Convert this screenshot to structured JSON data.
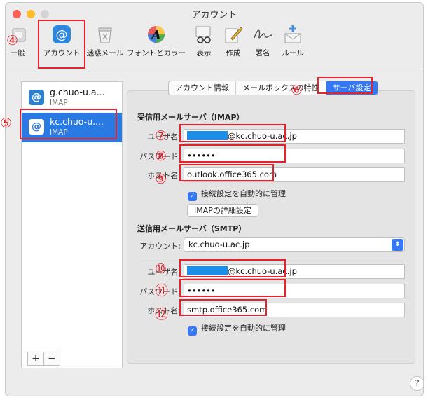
{
  "window": {
    "title": "アカウント"
  },
  "toolbar": {
    "items": [
      {
        "label": "一般",
        "icon": "general-icon"
      },
      {
        "label": "アカウント",
        "icon": "at-sign-icon"
      },
      {
        "label": "迷惑メール",
        "icon": "junk-mail-icon"
      },
      {
        "label": "フォントとカラー",
        "icon": "fonts-colors-icon"
      },
      {
        "label": "表示",
        "icon": "viewing-icon"
      },
      {
        "label": "作成",
        "icon": "composing-icon"
      },
      {
        "label": "署名",
        "icon": "signature-icon"
      },
      {
        "label": "ルール",
        "icon": "rules-icon"
      }
    ]
  },
  "sidebar": {
    "accounts": [
      {
        "name": "g.chuo-u.a...",
        "type": "IMAP"
      },
      {
        "name": "kc.chuo-u....",
        "type": "IMAP"
      }
    ],
    "add": "+",
    "remove": "−"
  },
  "tabs": [
    {
      "label": "アカウント情報"
    },
    {
      "label": "メールボックスの特性"
    },
    {
      "label": "サーバ設定"
    }
  ],
  "incoming": {
    "heading": "受信用メールサーバ（IMAP）",
    "username_label": "ユーザ名:",
    "username_suffix": "@kc.chuo-u.ac.jp",
    "password_label": "パスワード:",
    "password": "••••••",
    "host_label": "ホスト名:",
    "host": "outlook.office365.com",
    "auto_manage": "接続設定を自動的に管理",
    "advanced_button": "IMAPの詳細設定"
  },
  "outgoing": {
    "heading": "送信用メールサーバ（SMTP）",
    "account_label": "アカウント:",
    "account_value": "kc.chuo-u.ac.jp",
    "username_label": "ユーザ名:",
    "username_suffix": "@kc.chuo-u.ac.jp",
    "password_label": "パスワード:",
    "password": "••••••",
    "host_label": "ホスト名:",
    "host": "smtp.office365.com",
    "auto_manage": "接続設定を自動的に管理"
  },
  "annotations": {
    "n4": "④",
    "n5": "⑤",
    "n6": "⑥",
    "n7": "⑦",
    "n8": "⑧",
    "n9": "⑨",
    "n10": "⑩",
    "n11": "⑪",
    "n12": "⑫"
  },
  "help": "?",
  "colors": {
    "accent": "#3478f6",
    "annotation": "#e8222a",
    "masked": "#1a8ee8"
  }
}
